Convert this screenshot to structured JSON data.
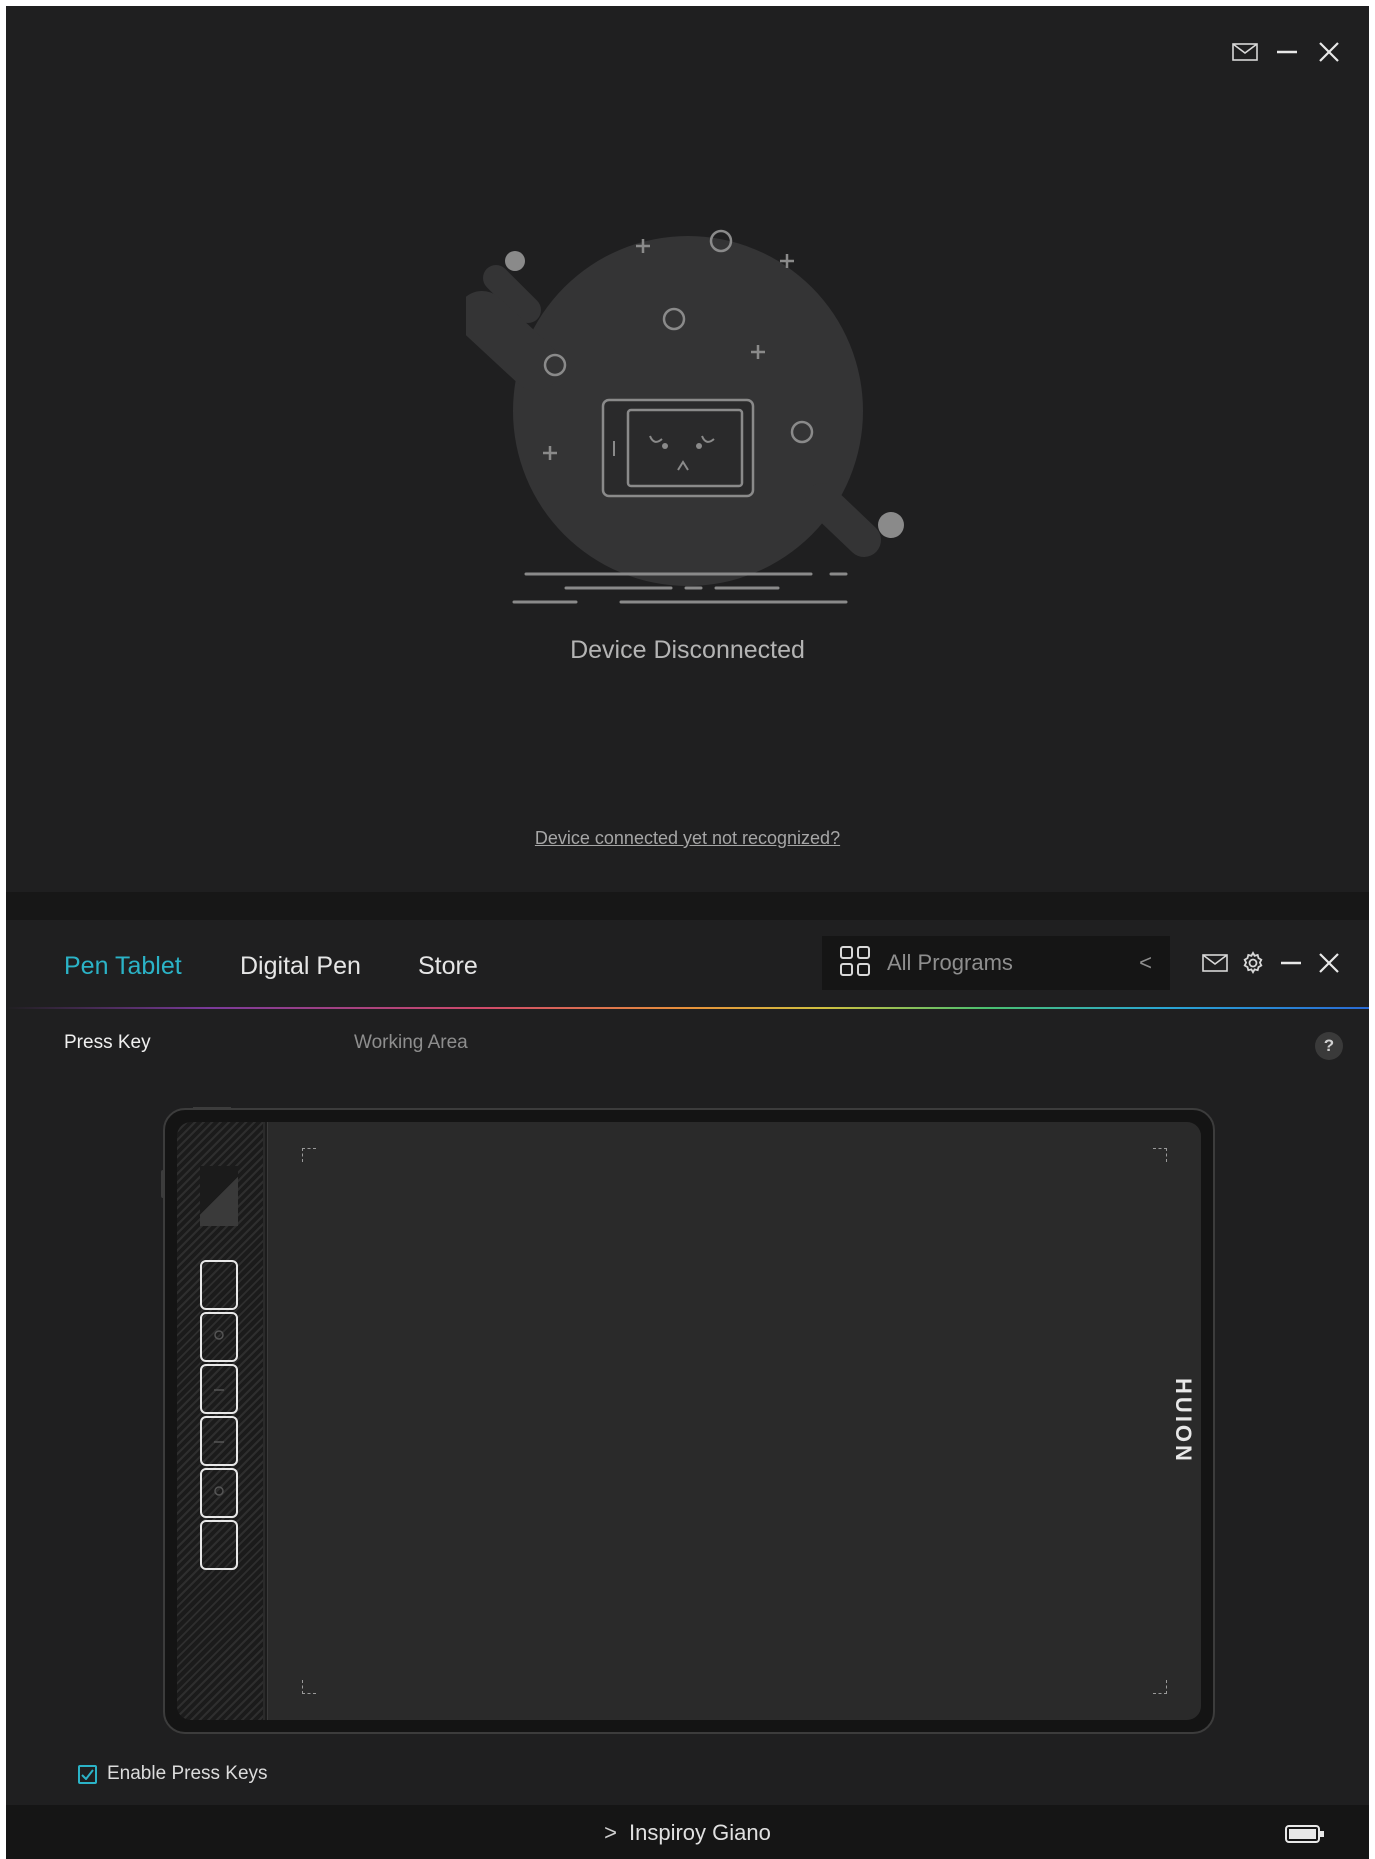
{
  "top_window": {
    "status_text": "Device Disconnected",
    "help_link": "Device connected yet not recognized?",
    "controls": [
      "mail-icon",
      "minimize-icon",
      "close-icon"
    ]
  },
  "bottom_window": {
    "tabs": [
      {
        "label": "Pen Tablet",
        "active": true
      },
      {
        "label": "Digital Pen",
        "active": false
      },
      {
        "label": "Store",
        "active": false
      }
    ],
    "program_selector": {
      "label": "All Programs",
      "icon": "grid-icon",
      "chevron": "<"
    },
    "controls": [
      "mail-icon",
      "gear-icon",
      "minimize-icon",
      "close-icon"
    ],
    "subtabs": [
      {
        "label": "Press Key",
        "active": true
      },
      {
        "label": "Working Area",
        "active": false
      }
    ],
    "help_button": "?",
    "tablet": {
      "brand": "HUION",
      "press_keys": 6
    },
    "enable_press_keys": {
      "label": "Enable Press Keys",
      "checked": true
    },
    "status_bar": {
      "device_name": "Inspiroy Giano",
      "arrow": ">",
      "battery_icon": "battery-icon"
    }
  },
  "colors": {
    "accent": "#2bb3c7",
    "background": "#1f1f20",
    "bar": "#151515"
  }
}
